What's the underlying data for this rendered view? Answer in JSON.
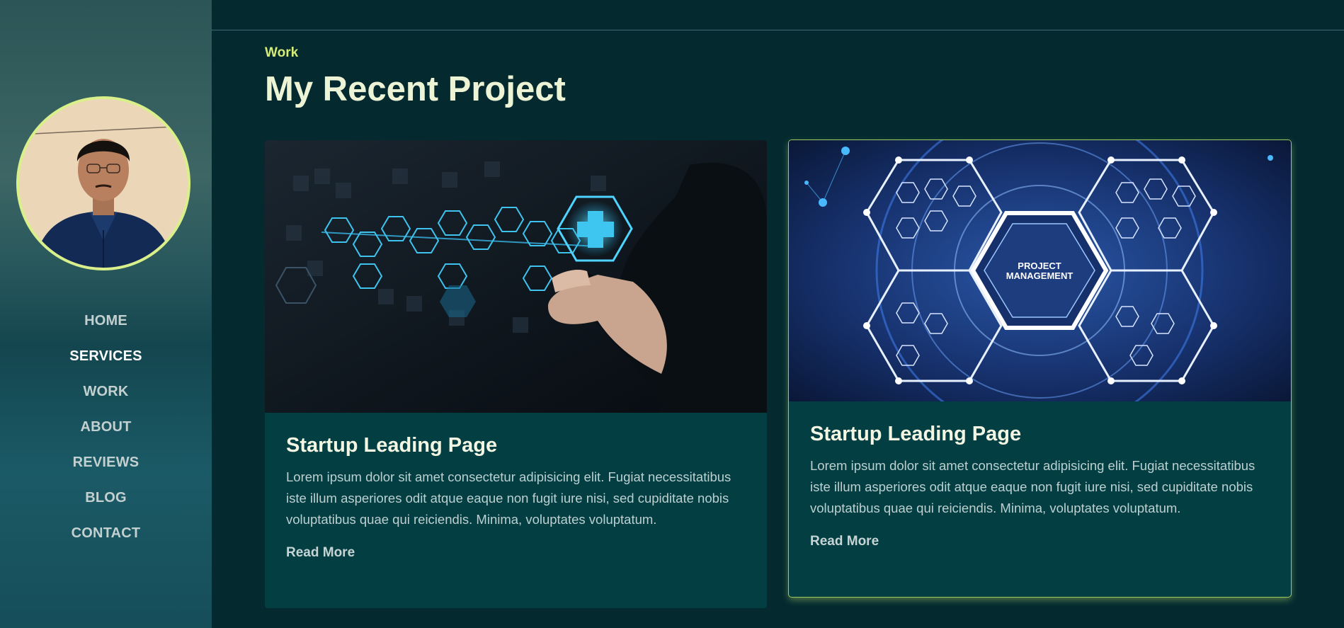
{
  "sidebar": {
    "profile_alt": "profile photo",
    "nav": [
      {
        "label": "HOME",
        "active": false
      },
      {
        "label": "SERVICES",
        "active": true
      },
      {
        "label": "WORK",
        "active": false
      },
      {
        "label": "ABOUT",
        "active": false
      },
      {
        "label": "REVIEWS",
        "active": false
      },
      {
        "label": "BLOG",
        "active": false
      },
      {
        "label": "CONTACT",
        "active": false
      }
    ]
  },
  "section": {
    "eyebrow": "Work",
    "title": "My Recent Project"
  },
  "projects": [
    {
      "title": "Startup Leading Page",
      "text": "Lorem ipsum dolor sit amet consectetur adipisicing elit. Fugiat necessitatibus iste illum asperiores odit atque eaque non fugit iure nisi, sed cupiditate nobis voluptatibus quae qui reiciendis. Minima, voluptates voluptatum.",
      "link": "Read More",
      "image": "medical-technology-image"
    },
    {
      "title": "Startup Leading Page",
      "text": "Lorem ipsum dolor sit amet consectetur adipisicing elit. Fugiat necessitatibus iste illum asperiores odit atque eaque non fugit iure nisi, sed cupiditate nobis voluptatibus quae qui reiciendis. Minima, voluptates voluptatum.",
      "link": "Read More",
      "image": "project-management-image",
      "image_text_1": "PROJECT",
      "image_text_2": "MANAGEMENT"
    }
  ],
  "colors": {
    "accent": "#d5ec79",
    "background": "#042a30",
    "card": "#033e43"
  }
}
